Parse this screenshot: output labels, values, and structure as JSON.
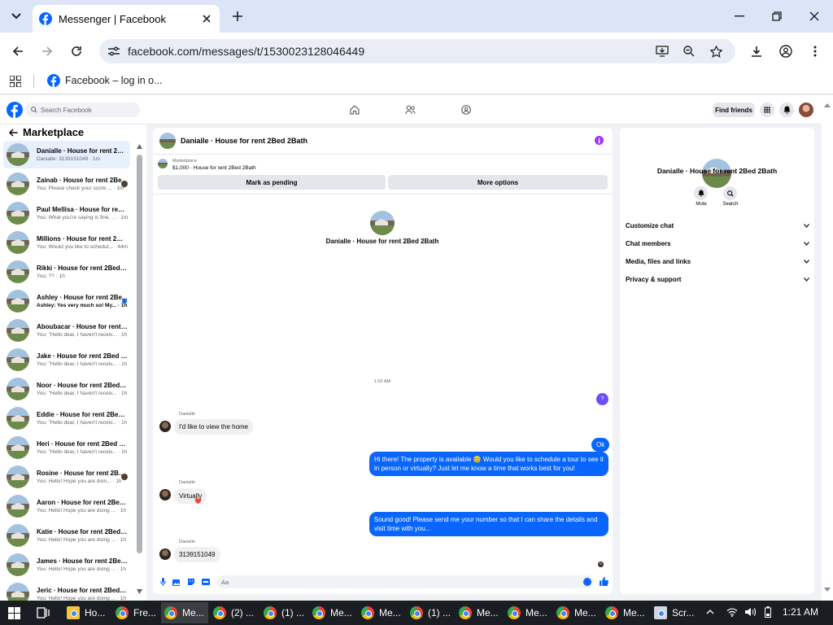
{
  "browser": {
    "tab_title": "Messenger | Facebook",
    "url": "facebook.com/messages/t/1530023128046449",
    "bookmark": "Facebook – log in o..."
  },
  "fb": {
    "search_placeholder": "Search Facebook",
    "find_friends": "Find friends"
  },
  "sidebar": {
    "title": "Marketplace",
    "conversations": [
      {
        "name": "Danialle · House for rent 2Bed...",
        "preview": "Danialle: 3139151049 · 1m",
        "selected": true
      },
      {
        "name": "Zainab · House for rent 2Be...",
        "preview": "You: Please check your score ... · 1m"
      },
      {
        "name": "Paul Mellisa · House for rent 2...",
        "preview": "You: What you're saying is fine, ... · 1m"
      },
      {
        "name": "Millions · House for rent 2Bed...",
        "preview": "You: Would you like to schedul... · 44m"
      },
      {
        "name": "Rikki · House for rent 2Bed 2B...",
        "preview": "You: ?? · 1h"
      },
      {
        "name": "Ashley · House for rent 2Be...",
        "preview": "Ashley: Yes very much so! My... · 1h",
        "unread": true
      },
      {
        "name": "Aboubacar · House for rent 2...",
        "preview": "You: \"Hello dear, I haven't receiv... · 1h"
      },
      {
        "name": "Jake · House for rent 2Bed 2B...",
        "preview": "You: \"Hello dear, I haven't receiv... · 1h"
      },
      {
        "name": "Noor · House for rent 2Bed 2B...",
        "preview": "You: \"Hello dear, I haven't receiv... · 1h"
      },
      {
        "name": "Eddie · House for rent 2Bed 2...",
        "preview": "You: \"Hello dear, I haven't receiv... · 1h"
      },
      {
        "name": "Heri · House for rent 2Bed 2B...",
        "preview": "You: \"Hello dear, I haven't receiv... · 1h"
      },
      {
        "name": "Rosine · House for rent 2Be...",
        "preview": "You: Hello! Hope you are doin... · 1h"
      },
      {
        "name": "Aaron · House for rent 2Bed 2...",
        "preview": "You: Hello! Hope you are doing ... · 1h"
      },
      {
        "name": "Katie · House for rent 2Bed 2B...",
        "preview": "You: Hello! Hope you are doing ... · 1h"
      },
      {
        "name": "James · House for rent 2Bed 2...",
        "preview": "You: Hello! Hope you are doing ... · 1h"
      },
      {
        "name": "Jeric · House for rent 2Bed 2B...",
        "preview": "You: Hello! Hope you are doing ... · 1h"
      }
    ]
  },
  "chat": {
    "header_title": "Danialle · House for rent 2Bed 2Bath",
    "listing_label": "Marketplace",
    "listing_detail": "$1,000 · House for rent 2Bed 2Bath",
    "mark_pending": "Mark as pending",
    "more_options": "More options",
    "center_name": "Danialle · House for rent 2Bed 2Bath",
    "timestamp": "1:02 AM",
    "question_mark": "?",
    "sender": "Danialle",
    "msg1": "I'd like to view the home",
    "ok": "Ok",
    "out1": "Hi there! The property is available 😊 Would you like to schedule a tour to see it in person or virtually? Just let me know a time that works best for you!",
    "msg2": "Virtually",
    "reaction": "❤️",
    "out2": "Sound good! Please send me your number so that I can share the details and visit time with you...",
    "msg3": "3139151049",
    "composer_placeholder": "Aa"
  },
  "info": {
    "name": "Danialle · House for rent 2Bed 2Bath",
    "mute": "Mute",
    "search": "Search",
    "rows": [
      "Customize chat",
      "Chat members",
      "Media, files and links",
      "Privacy & support"
    ]
  },
  "taskbar": {
    "items": [
      "Ho...",
      "Fre...",
      "Me...",
      "(2) ...",
      "(1) ...",
      "Me...",
      "Me...",
      "(1) ...",
      "Me...",
      "Me...",
      "Me...",
      "Me...",
      "Scr..."
    ],
    "time": "1:21 AM"
  },
  "colors": {
    "accent": "#0866ff",
    "purple": "#a033ff"
  }
}
